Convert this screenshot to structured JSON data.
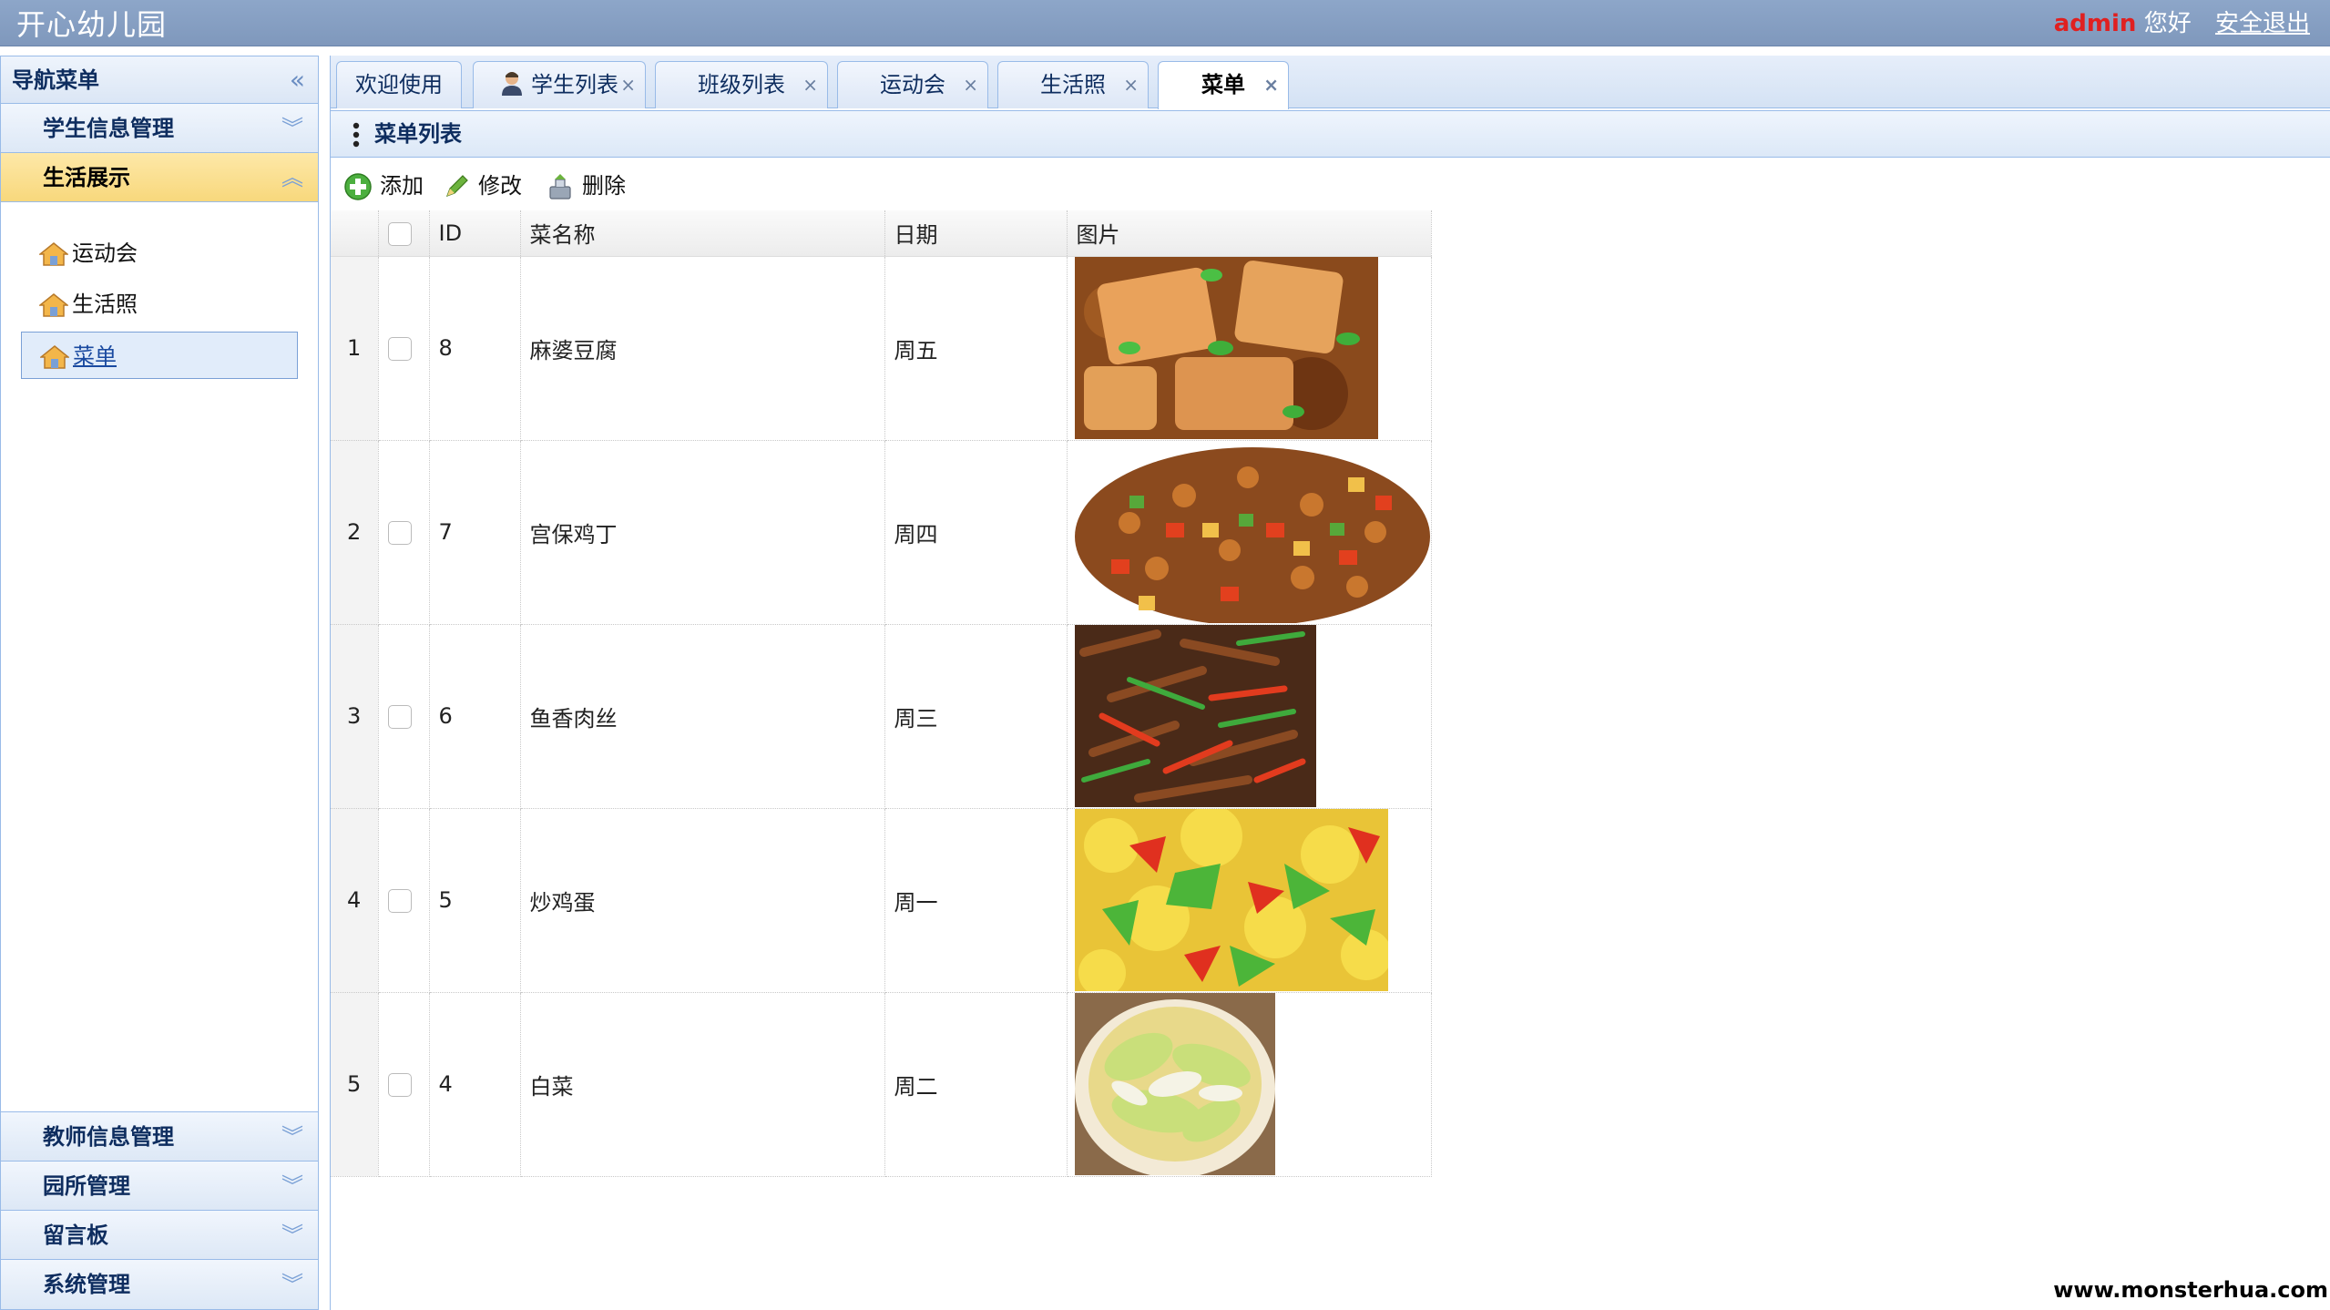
{
  "header": {
    "title": "开心幼儿园",
    "user": "admin",
    "greeting": "您好",
    "logout": "安全退出"
  },
  "sidebar": {
    "title": "导航菜单",
    "sections_top": [
      {
        "label": "学生信息管理",
        "expanded": false
      },
      {
        "label": "生活展示",
        "expanded": true
      }
    ],
    "tree": [
      {
        "label": "运动会",
        "selected": false
      },
      {
        "label": "生活照",
        "selected": false
      },
      {
        "label": "菜单",
        "selected": true
      }
    ],
    "sections_bottom": [
      {
        "label": "教师信息管理"
      },
      {
        "label": "园所管理"
      },
      {
        "label": "留言板"
      },
      {
        "label": "系统管理"
      }
    ]
  },
  "tabs": [
    {
      "label": "欢迎使用",
      "closable": false,
      "active": false
    },
    {
      "label": "学生列表",
      "closable": true,
      "active": false,
      "icon": "student-icon"
    },
    {
      "label": "班级列表",
      "closable": true,
      "active": false
    },
    {
      "label": "运动会",
      "closable": true,
      "active": false
    },
    {
      "label": "生活照",
      "closable": true,
      "active": false
    },
    {
      "label": "菜单",
      "closable": true,
      "active": true
    }
  ],
  "panel": {
    "title": "菜单列表"
  },
  "toolbar": {
    "add": "添加",
    "edit": "修改",
    "delete": "删除"
  },
  "grid": {
    "columns": [
      "ID",
      "菜名称",
      "日期",
      "图片"
    ],
    "rows": [
      {
        "num": "1",
        "id": "8",
        "name": "麻婆豆腐",
        "day": "周五",
        "image": "mapo-tofu-photo"
      },
      {
        "num": "2",
        "id": "7",
        "name": "宫保鸡丁",
        "day": "周四",
        "image": "kung-pao-chicken-photo"
      },
      {
        "num": "3",
        "id": "6",
        "name": "鱼香肉丝",
        "day": "周三",
        "image": "yuxiang-pork-photo"
      },
      {
        "num": "4",
        "id": "5",
        "name": "炒鸡蛋",
        "day": "周一",
        "image": "scrambled-eggs-photo"
      },
      {
        "num": "5",
        "id": "4",
        "name": "白菜",
        "day": "周二",
        "image": "cabbage-photo"
      }
    ]
  },
  "watermark": "www.monsterhua.com",
  "colors": {
    "header_bg": "#8da6c9",
    "active_section": "#f8d87c",
    "border": "#99bbe8",
    "user_red": "#e02020"
  }
}
